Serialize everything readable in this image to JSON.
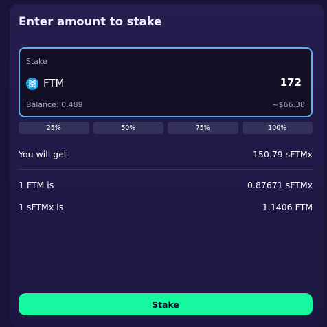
{
  "header": {
    "title": "Enter amount to stake"
  },
  "stake_input": {
    "label": "Stake",
    "token_icon": "fantom-icon",
    "token": "FTM",
    "amount": "172",
    "balance": "Balance: 0.489",
    "usd_value": "~$66.38"
  },
  "percent_buttons": [
    "25%",
    "50%",
    "75%",
    "100%"
  ],
  "summary": {
    "receive_label": "You will get",
    "receive_value": "150.79 sFTMx",
    "rate1_label": "1 FTM is",
    "rate1_value": "0.87671 sFTMx",
    "rate2_label": "1 sFTMx is",
    "rate2_value": "1.1406 FTM"
  },
  "action": {
    "label": "Stake"
  },
  "colors": {
    "background": "#181339",
    "card": "#221c4c",
    "input_border": "#5fb2ef",
    "accent": "#16f89f",
    "token_icon": "#1aa2e7"
  }
}
